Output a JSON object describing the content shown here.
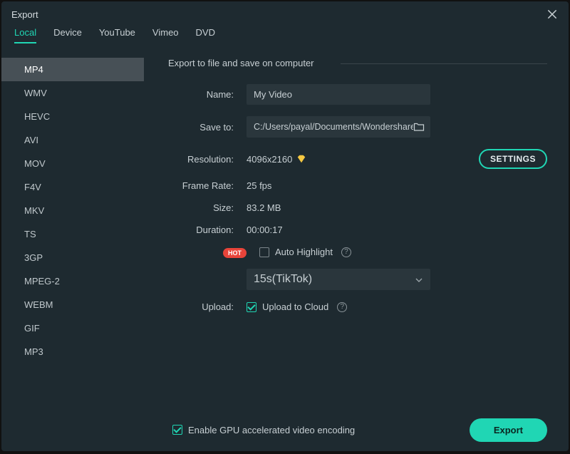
{
  "window": {
    "title": "Export"
  },
  "tabs": [
    {
      "label": "Local",
      "active": true
    },
    {
      "label": "Device"
    },
    {
      "label": "YouTube"
    },
    {
      "label": "Vimeo"
    },
    {
      "label": "DVD"
    }
  ],
  "formats": [
    {
      "label": "MP4",
      "selected": true
    },
    {
      "label": "WMV"
    },
    {
      "label": "HEVC"
    },
    {
      "label": "AVI"
    },
    {
      "label": "MOV"
    },
    {
      "label": "F4V"
    },
    {
      "label": "MKV"
    },
    {
      "label": "TS"
    },
    {
      "label": "3GP"
    },
    {
      "label": "MPEG-2"
    },
    {
      "label": "WEBM"
    },
    {
      "label": "GIF"
    },
    {
      "label": "MP3"
    }
  ],
  "main": {
    "section_title": "Export to file and save on computer",
    "labels": {
      "name": "Name:",
      "saveto": "Save to:",
      "resolution": "Resolution:",
      "frame_rate": "Frame Rate:",
      "size": "Size:",
      "duration": "Duration:",
      "upload": "Upload:"
    },
    "values": {
      "name": "My Video",
      "saveto": "C:/Users/payal/Documents/Wondershare/",
      "resolution": "4096x2160",
      "frame_rate": "25 fps",
      "size": "83.2 MB",
      "duration": "00:00:17"
    },
    "settings_btn": "SETTINGS",
    "hot_badge": "HOT",
    "auto_highlight": {
      "label": "Auto Highlight",
      "checked": false
    },
    "highlight_select": "15s(TikTok)",
    "upload_cloud": {
      "label": "Upload to Cloud",
      "checked": true
    }
  },
  "footer": {
    "gpu": {
      "label": "Enable GPU accelerated video encoding",
      "checked": true
    },
    "export_btn": "Export"
  },
  "icons": {
    "close": "close",
    "folder": "folder",
    "diamond": "premium-diamond",
    "help": "?",
    "chevron_down": "chevron-down"
  },
  "colors": {
    "accent": "#20d6b4",
    "bg": "#1e2a30",
    "input_bg": "#2a363c",
    "hot": "#e8443a"
  }
}
